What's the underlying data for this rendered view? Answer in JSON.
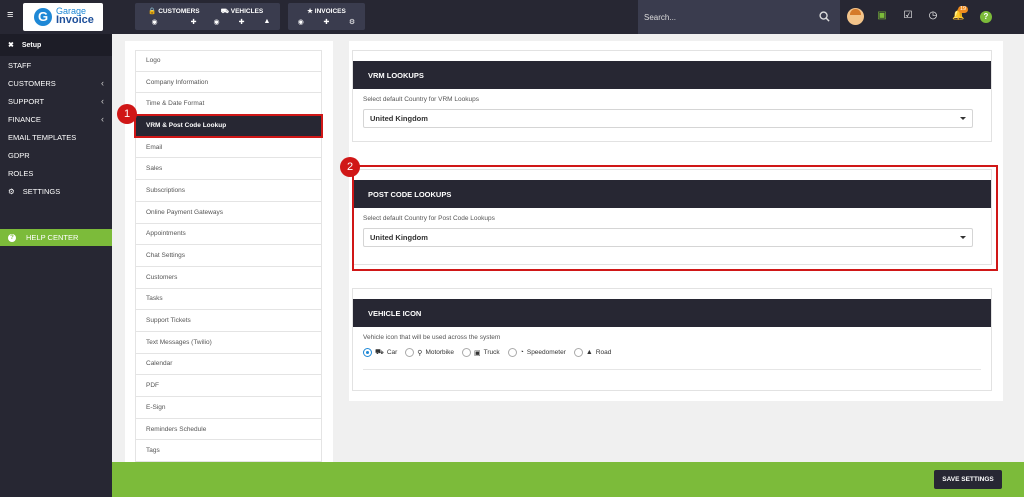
{
  "app": {
    "logo_line1": "Garage",
    "logo_line2": "Invoice",
    "logo_letter": "G"
  },
  "colors": {
    "sidebar_bg": "#272733",
    "accent_green": "#7cbb3a",
    "annotation_red": "#d01717",
    "badge_orange": "#f08c1e"
  },
  "topbar": {
    "groups": [
      {
        "label": "CUSTOMERS",
        "icon": "lock-icon",
        "actions": [
          "eye-icon",
          "plus-icon"
        ]
      },
      {
        "label": "VEHICLES",
        "icon": "car-icon",
        "actions": [
          "eye-icon",
          "plus-icon",
          "bell-icon"
        ]
      },
      {
        "label": "INVOICES",
        "icon": "star-icon",
        "actions": [
          "eye-icon",
          "plus-icon",
          "cog-icon"
        ]
      }
    ],
    "search_placeholder": "Search...",
    "notification_count": "19"
  },
  "sidebar": {
    "setup_label": "Setup",
    "items": [
      {
        "label": "STAFF",
        "has_chevron": false
      },
      {
        "label": "CUSTOMERS",
        "has_chevron": true
      },
      {
        "label": "SUPPORT",
        "has_chevron": true
      },
      {
        "label": "FINANCE",
        "has_chevron": true
      },
      {
        "label": "EMAIL TEMPLATES",
        "has_chevron": false
      },
      {
        "label": "GDPR",
        "has_chevron": false
      },
      {
        "label": "ROLES",
        "has_chevron": false
      },
      {
        "label": "SETTINGS",
        "has_chevron": false
      }
    ],
    "help_label": "HELP CENTER"
  },
  "settings_menu": {
    "active_index": 3,
    "items": [
      "Logo",
      "Company Information",
      "Time & Date Format",
      "VRM & Post Code Lookup",
      "Email",
      "Sales",
      "Subscriptions",
      "Online Payment Gateways",
      "Appointments",
      "Chat Settings",
      "Customers",
      "Tasks",
      "Support Tickets",
      "Text Messages (Twilio)",
      "Calendar",
      "PDF",
      "E-Sign",
      "Reminders Schedule",
      "Tags"
    ]
  },
  "vrm": {
    "title": "VRM LOOKUPS",
    "label": "Select default Country for VRM Lookups",
    "value": "United Kingdom"
  },
  "postcode": {
    "title": "POST CODE LOOKUPS",
    "label": "Select default Country for Post Code Lookups",
    "value": "United Kingdom"
  },
  "vehicle_icon": {
    "title": "VEHICLE ICON",
    "label": "Vehicle icon that will be used across the system",
    "selected": "Car",
    "options": [
      {
        "label": "Car",
        "icon": "car-icon"
      },
      {
        "label": "Motorbike",
        "icon": "motorbike-icon"
      },
      {
        "label": "Truck",
        "icon": "truck-icon"
      },
      {
        "label": "Speedometer",
        "icon": "speedometer-icon"
      },
      {
        "label": "Road",
        "icon": "road-icon"
      }
    ]
  },
  "annotations": {
    "marker1": "1",
    "marker2": "2"
  },
  "footer": {
    "save_label": "SAVE SETTINGS"
  }
}
